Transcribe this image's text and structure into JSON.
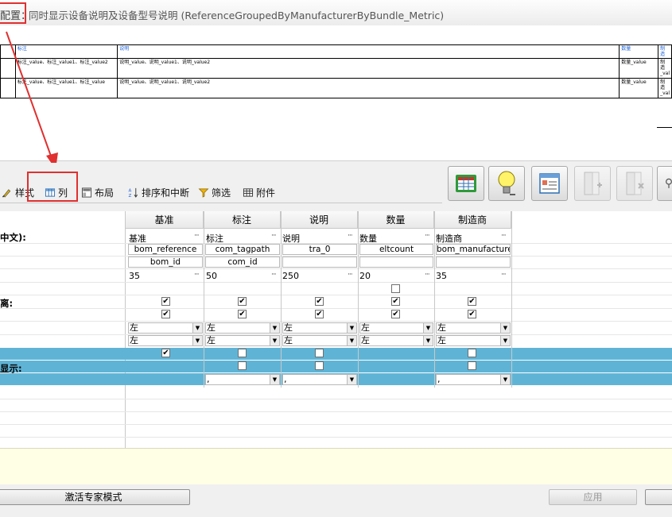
{
  "window": {
    "title_prefix": "配置：",
    "title_main": "同时显示设备说明及设备型号说明 (ReferenceGroupedByManufacturerByBundle_Metric)"
  },
  "preview": {
    "headers": [
      "",
      "标注",
      "说明",
      "数量",
      "制造"
    ],
    "rows": [
      [
        "",
        "标注_value、标注_value1、标注_value2",
        "说明_value、说明_value1、说明_value2",
        "数量_value",
        "制造_val"
      ],
      [
        "",
        "标注_value、标注_value1、标注_value",
        "说明_value、说明_value1、说明_value2",
        "数量_value",
        "制造_val"
      ]
    ]
  },
  "toolbar": {
    "tabs": [
      {
        "label": "样式",
        "icon": "style-brush-icon"
      },
      {
        "label": "列",
        "icon": "columns-grid-icon"
      },
      {
        "label": "布局",
        "icon": "layout-icon"
      },
      {
        "label": "排序和中断",
        "icon": "sort-az-icon"
      },
      {
        "label": "筛选",
        "icon": "filter-funnel-icon"
      },
      {
        "label": "附件",
        "icon": "attachment-table-icon"
      }
    ],
    "buttons": [
      {
        "icon": "table-view-icon",
        "enabled": true
      },
      {
        "icon": "lightbulb-icon",
        "enabled": true
      },
      {
        "icon": "properties-form-icon",
        "enabled": true
      },
      {
        "icon": "insert-column-icon",
        "enabled": false
      },
      {
        "icon": "delete-column-icon",
        "enabled": false
      }
    ]
  },
  "grid": {
    "row_labels": [
      "中文):",
      "离:",
      "显示:"
    ],
    "columns": [
      {
        "header": "基准",
        "name": "基准",
        "property": "bom_reference",
        "secondary": "bom_id",
        "width": "35",
        "align1": "左",
        "align2": "左",
        "link": ""
      },
      {
        "header": "标注",
        "name": "标注",
        "property": "com_tagpath",
        "secondary": "com_id",
        "width": "50",
        "align1": "左",
        "align2": "左",
        "link": ","
      },
      {
        "header": "说明",
        "name": "说明",
        "property": "tra_0",
        "secondary": "",
        "width": "250",
        "align1": "左",
        "align2": "左",
        "link": ","
      },
      {
        "header": "数量",
        "name": "数量",
        "property": "eltcount",
        "secondary": "",
        "width": "20",
        "align1": "左",
        "align2": "左",
        "link": ""
      },
      {
        "header": "制造商",
        "name": "制造商",
        "property": "bom_manufacturer",
        "secondary": "",
        "width": "35",
        "align1": "左",
        "align2": "左",
        "link": ","
      }
    ],
    "check_glyph": "✔"
  },
  "footer": {
    "expert_mode": "激活专家模式",
    "apply": "应用"
  },
  "colors": {
    "highlight": "#e03030",
    "band": "#5fb4d6",
    "link_header": "#1a5fd6"
  }
}
